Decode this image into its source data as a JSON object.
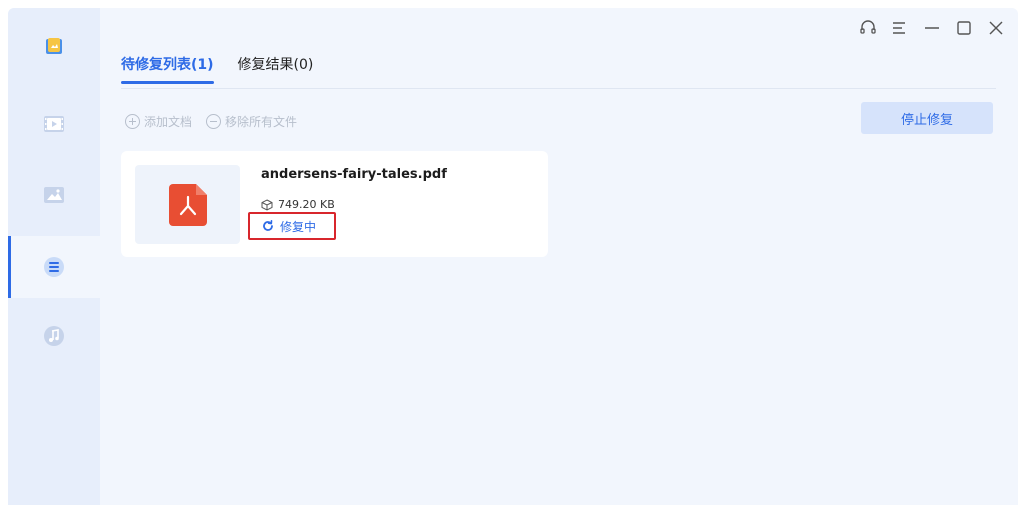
{
  "window_controls": {
    "icons": [
      "headset-icon",
      "menu-icon",
      "minimize-icon",
      "maximize-icon",
      "close-icon"
    ]
  },
  "sidebar": {
    "items": [
      {
        "icon": "photo-folder-icon",
        "active": false
      },
      {
        "icon": "video-icon",
        "active": false
      },
      {
        "icon": "image-icon",
        "active": false
      },
      {
        "icon": "document-icon",
        "active": true
      },
      {
        "icon": "audio-icon",
        "active": false
      }
    ]
  },
  "tabs": [
    {
      "label": "待修复列表(1)",
      "active": true
    },
    {
      "label": "修复结果(0)",
      "active": false
    }
  ],
  "toolbar": {
    "add_label": "添加文档",
    "remove_label": "移除所有文件",
    "stop_label": "停止修复"
  },
  "file": {
    "name": "andersens-fairy-tales.pdf",
    "size": "749.20 KB",
    "status": "修复中",
    "type_icon": "pdf-icon"
  },
  "colors": {
    "accent": "#2e6be6",
    "sidebar_bg": "#e7eefb",
    "content_bg": "#f2f6fd",
    "pdf_red": "#e84e33",
    "highlight": "#d8262c"
  }
}
